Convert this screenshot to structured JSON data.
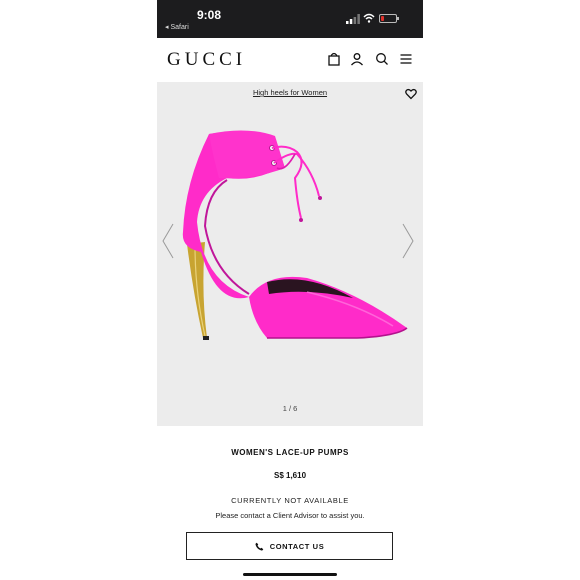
{
  "status_bar": {
    "time": "9:08",
    "back_app": "◂ Safari"
  },
  "header": {
    "logo": "GUCCI",
    "icons": [
      "shopping-bag-icon",
      "user-icon",
      "search-icon",
      "menu-icon"
    ]
  },
  "gallery": {
    "breadcrumb": "High heels for Women",
    "image_counter": "1 / 6",
    "colors": {
      "shoe": "#ff2bc9",
      "heel": "#c8a431",
      "background": "#ececec"
    }
  },
  "product": {
    "name": "WOMEN'S LACE-UP PUMPS",
    "price": "S$ 1,610",
    "availability": "CURRENTLY NOT AVAILABLE",
    "advisor_note": "Please contact a Client Advisor to assist you.",
    "contact_label": "CONTACT US"
  }
}
